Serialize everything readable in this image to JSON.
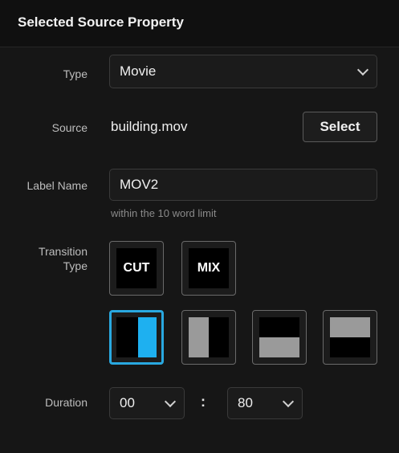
{
  "header": {
    "title": "Selected Source Property"
  },
  "type": {
    "label": "Type",
    "value": "Movie"
  },
  "source": {
    "label": "Source",
    "value": "building.mov",
    "button": "Select"
  },
  "label_name": {
    "label": "Label Name",
    "value": "MOV2",
    "hint": "within the 10 word limit"
  },
  "transition": {
    "label_line1": "Transition",
    "label_line2": "Type",
    "cut": "CUT",
    "mix": "MIX",
    "wipes": [
      {
        "name": "wipe-right-half",
        "selected": true
      },
      {
        "name": "wipe-left-half",
        "selected": false
      },
      {
        "name": "wipe-bottom-half",
        "selected": false
      },
      {
        "name": "wipe-top-half",
        "selected": false
      }
    ],
    "colors": {
      "selected_border": "#29a8e0",
      "selected_fill": "#1eb0f0",
      "gray_fill": "#9a9a9a"
    }
  },
  "duration": {
    "label": "Duration",
    "seconds": "00",
    "separator": ":",
    "frames": "80"
  }
}
